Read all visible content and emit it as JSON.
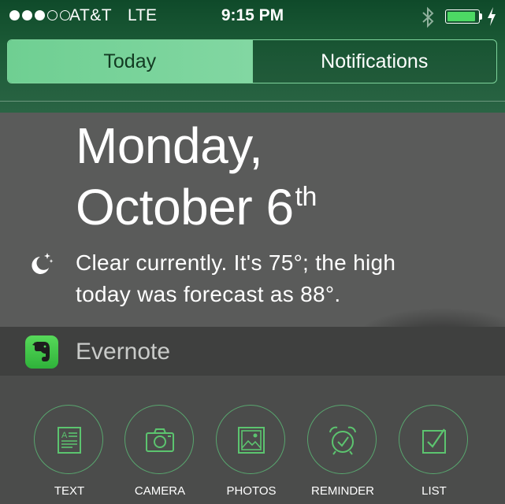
{
  "status_bar": {
    "signal_bars_filled": 3,
    "signal_bars_total": 5,
    "carrier": "AT&T",
    "network": "LTE",
    "time": "9:15 PM",
    "battery_level": 0.95,
    "battery_color": "#4cd964"
  },
  "tabs": [
    {
      "label": "Today",
      "active": true
    },
    {
      "label": "Notifications",
      "active": false
    }
  ],
  "today": {
    "day": "Monday,",
    "date": "October 6",
    "date_suffix": "th",
    "weather_icon": "moon-stars-icon",
    "weather_line1": "Clear currently. It's 75°; the high",
    "weather_line2": "today was forecast as 88°."
  },
  "widget": {
    "name": "Evernote",
    "icon": "evernote-elephant-icon",
    "accent": "#4cd964",
    "actions": [
      {
        "label": "TEXT",
        "icon": "text-note-icon"
      },
      {
        "label": "CAMERA",
        "icon": "camera-icon"
      },
      {
        "label": "PHOTOS",
        "icon": "photos-icon"
      },
      {
        "label": "REMINDER",
        "icon": "alarm-clock-icon"
      },
      {
        "label": "LIST",
        "icon": "checkbox-icon"
      }
    ]
  }
}
